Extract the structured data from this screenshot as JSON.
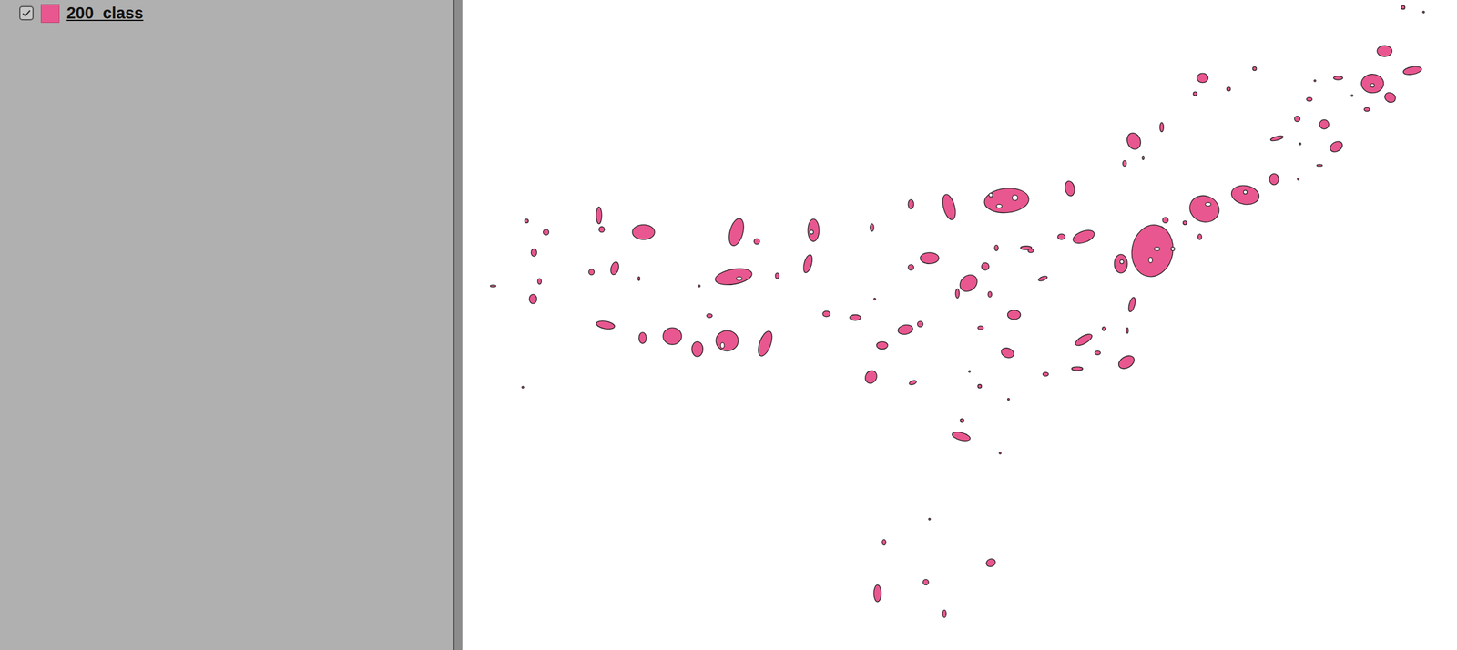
{
  "layers_panel": {
    "layers": [
      {
        "name": "200_class",
        "checked": true,
        "selected": true,
        "color": "#e8578f"
      }
    ]
  }
}
